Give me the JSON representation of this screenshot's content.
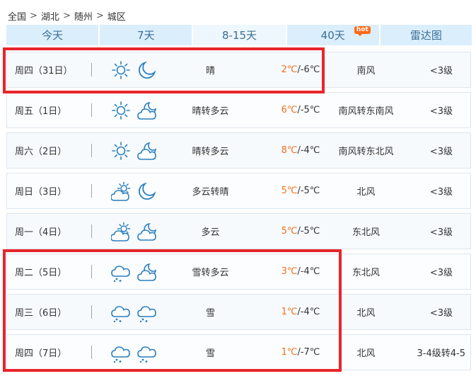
{
  "breadcrumb": {
    "items": [
      "全国",
      "湖北",
      "随州",
      "城区"
    ],
    "separator": ">"
  },
  "tabs": [
    {
      "label": "今天"
    },
    {
      "label": "7天"
    },
    {
      "label": "8-15天",
      "active": true
    },
    {
      "label": "40天",
      "badge": "hot"
    },
    {
      "label": "雷达图"
    }
  ],
  "colors": {
    "accent": "#3b6e96",
    "high_temp": "#f0701e",
    "highlight": "#e8252a",
    "icon": "#2a7fc0"
  },
  "forecast": [
    {
      "day": "周四（31日）",
      "icons": [
        "sun-icon",
        "moon-icon"
      ],
      "desc": "晴",
      "high": "2℃",
      "low": "/-6℃",
      "wind": "南风",
      "level": "<3级"
    },
    {
      "day": "周五（1日）",
      "icons": [
        "sun-icon",
        "moon-cloud-icon"
      ],
      "desc": "晴转多云",
      "high": "6℃",
      "low": "/-5℃",
      "wind": "南风转东南风",
      "level": "<3级"
    },
    {
      "day": "周六（2日）",
      "icons": [
        "sun-icon",
        "moon-cloud-icon"
      ],
      "desc": "晴转多云",
      "high": "8℃",
      "low": "/-4℃",
      "wind": "南风转东北风",
      "level": "<3级"
    },
    {
      "day": "周日（3日）",
      "icons": [
        "sun-cloud-icon",
        "moon-icon"
      ],
      "desc": "多云转晴",
      "high": "5℃",
      "low": "/-5℃",
      "wind": "北风",
      "level": "<3级"
    },
    {
      "day": "周一（4日）",
      "icons": [
        "sun-cloud-icon",
        "moon-cloud-icon"
      ],
      "desc": "多云",
      "high": "5℃",
      "low": "/-5℃",
      "wind": "东北风",
      "level": "<3级"
    },
    {
      "day": "周二（5日）",
      "icons": [
        "snow-icon",
        "moon-cloud-icon"
      ],
      "desc": "雪转多云",
      "high": "3℃",
      "low": "/-4℃",
      "wind": "东北风",
      "level": "<3级"
    },
    {
      "day": "周三（6日）",
      "icons": [
        "snow-icon",
        "snow-icon"
      ],
      "desc": "雪",
      "high": "1℃",
      "low": "/-4℃",
      "wind": "北风",
      "level": "<3级"
    },
    {
      "day": "周四（7日）",
      "icons": [
        "snow-icon",
        "snow-icon"
      ],
      "desc": "雪",
      "high": "1℃",
      "low": "/-7℃",
      "wind": "北风",
      "level": "3-4级转4-5"
    }
  ]
}
